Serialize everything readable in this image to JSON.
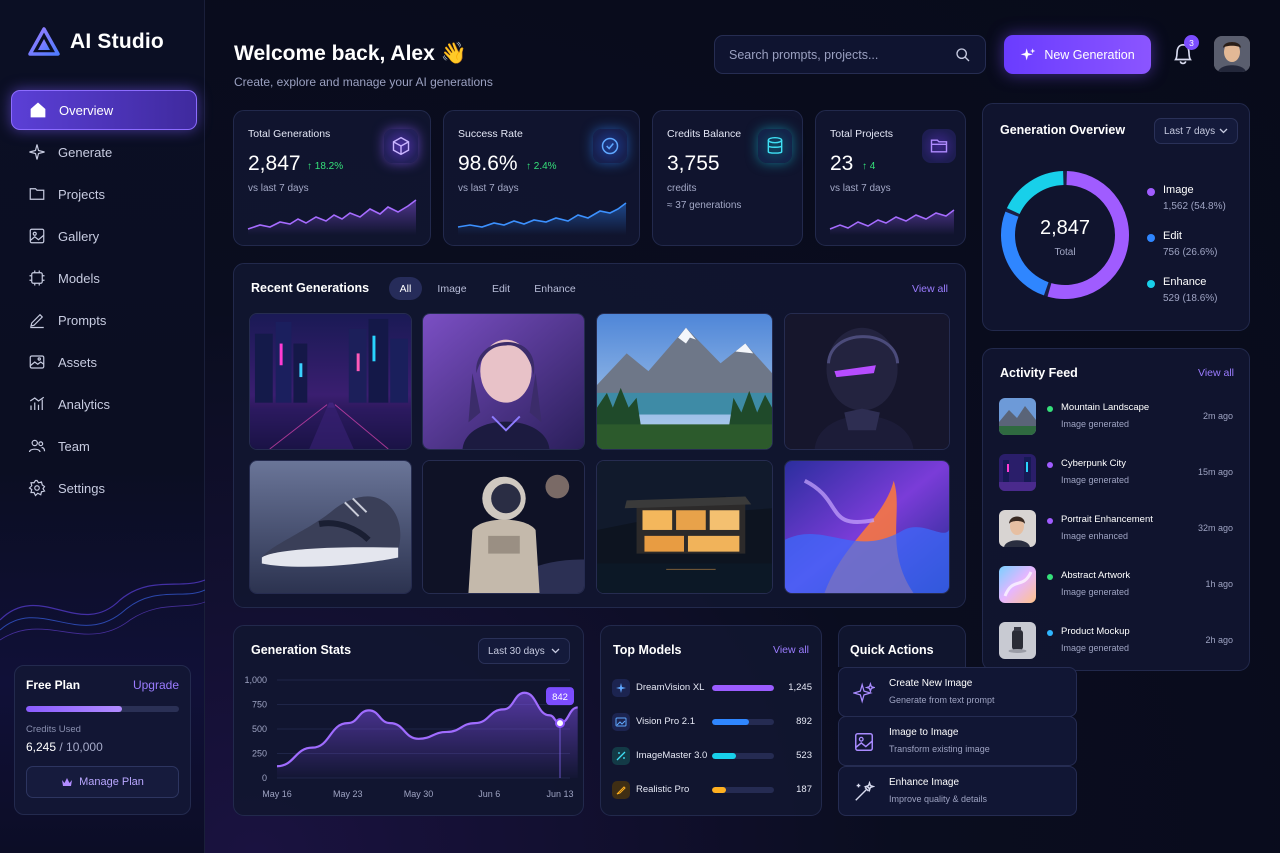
{
  "app": {
    "name": "AI Studio"
  },
  "sidebar": {
    "items": [
      {
        "label": "Overview",
        "icon": "home-icon"
      },
      {
        "label": "Generate",
        "icon": "sparkle-icon"
      },
      {
        "label": "Projects",
        "icon": "folder-icon"
      },
      {
        "label": "Gallery",
        "icon": "image-icon"
      },
      {
        "label": "Models",
        "icon": "cube-grid-icon"
      },
      {
        "label": "Prompts",
        "icon": "pen-icon"
      },
      {
        "label": "Assets",
        "icon": "photo-icon"
      },
      {
        "label": "Analytics",
        "icon": "chart-icon"
      },
      {
        "label": "Team",
        "icon": "users-icon"
      },
      {
        "label": "Settings",
        "icon": "gear-icon"
      }
    ],
    "plan": {
      "title": "Free Plan",
      "upgrade": "Upgrade",
      "credits_label": "Credits Used",
      "credits_used": "6,245",
      "credits_total": "/ 10,000",
      "usage_fraction": 0.6245,
      "manage": "Manage Plan"
    }
  },
  "header": {
    "title": "Welcome back, Alex",
    "wave": "👋",
    "subtitle": "Create, explore and manage your AI generations",
    "search_placeholder": "Search prompts, projects...",
    "new_button": "New Generation",
    "notifications": "3"
  },
  "stats": [
    {
      "label": "Total Generations",
      "value": "2,847",
      "change": "↑ 18.2%",
      "note": "vs last 7 days",
      "icon": "cube-icon"
    },
    {
      "label": "Success Rate",
      "value": "98.6%",
      "change": "↑ 2.4%",
      "note": "vs last 7 days",
      "icon": "check-circle-icon"
    },
    {
      "label": "Credits Balance",
      "value": "3,755",
      "note": "credits",
      "note2": "≈ 37 generations",
      "icon": "database-icon"
    },
    {
      "label": "Total Projects",
      "value": "23",
      "change": "↑ 4",
      "note": "vs last 7 days",
      "icon": "folder-icon"
    }
  ],
  "recent": {
    "title": "Recent Generations",
    "filters": [
      "All",
      "Image",
      "Edit",
      "Enhance"
    ],
    "view_all": "View all"
  },
  "overview": {
    "title": "Generation Overview",
    "range": "Last 7 days",
    "total": "2,847",
    "total_label": "Total",
    "legend": [
      {
        "name": "Image",
        "detail": "1,562 (54.8%)",
        "color": "#a05cff"
      },
      {
        "name": "Edit",
        "detail": "756 (26.6%)",
        "color": "#2f86ff"
      },
      {
        "name": "Enhance",
        "detail": "529 (18.6%)",
        "color": "#18d0ea"
      }
    ]
  },
  "activity": {
    "title": "Activity Feed",
    "view_all": "View all",
    "items": [
      {
        "title": "Mountain Landscape",
        "status": "Image generated",
        "time": "2m ago",
        "dot": "#35e07a"
      },
      {
        "title": "Cyberpunk City",
        "status": "Image generated",
        "time": "15m ago",
        "dot": "#a05cff"
      },
      {
        "title": "Portrait Enhancement",
        "status": "Image enhanced",
        "time": "32m ago",
        "dot": "#a05cff"
      },
      {
        "title": "Abstract Artwork",
        "status": "Image generated",
        "time": "1h ago",
        "dot": "#35e07a"
      },
      {
        "title": "Product Mockup",
        "status": "Image generated",
        "time": "2h ago",
        "dot": "#2fb6ff"
      }
    ]
  },
  "gen_stats": {
    "title": "Generation Stats",
    "range": "Last 30 days",
    "tooltip": "842"
  },
  "chart_data": {
    "type": "area",
    "x": [
      "May 16",
      "May 23",
      "May 30",
      "Jun 6",
      "Jun 13"
    ],
    "yticks": [
      "1,000",
      "750",
      "500",
      "250",
      "0"
    ],
    "ylim": [
      0,
      1000
    ],
    "points": [
      [
        0,
        120
      ],
      [
        0.5,
        310
      ],
      [
        1,
        560
      ],
      [
        1.3,
        690
      ],
      [
        1.6,
        560
      ],
      [
        2,
        400
      ],
      [
        2.4,
        470
      ],
      [
        2.8,
        560
      ],
      [
        3.2,
        700
      ],
      [
        3.5,
        870
      ],
      [
        3.85,
        640
      ],
      [
        4.0,
        560
      ],
      [
        4.25,
        720
      ]
    ],
    "highlight": {
      "x": 4.0,
      "value": 842
    }
  },
  "models": {
    "title": "Top Models",
    "view_all": "View all",
    "items": [
      {
        "name": "DreamVision XL",
        "value": "1,245",
        "fraction": 1.0,
        "color": "#9b5cff"
      },
      {
        "name": "Vision Pro 2.1",
        "value": "892",
        "fraction": 0.6,
        "color": "#2f86ff"
      },
      {
        "name": "ImageMaster 3.0",
        "value": "523",
        "fraction": 0.38,
        "color": "#18d0ea"
      },
      {
        "name": "Realistic Pro",
        "value": "187",
        "fraction": 0.22,
        "color": "#ffb020"
      }
    ]
  },
  "quick": {
    "title": "Quick Actions",
    "items": [
      {
        "title": "Create New Image",
        "sub": "Generate from text prompt"
      },
      {
        "title": "Image to Image",
        "sub": "Transform existing image"
      },
      {
        "title": "Enhance Image",
        "sub": "Improve quality & details"
      }
    ]
  }
}
